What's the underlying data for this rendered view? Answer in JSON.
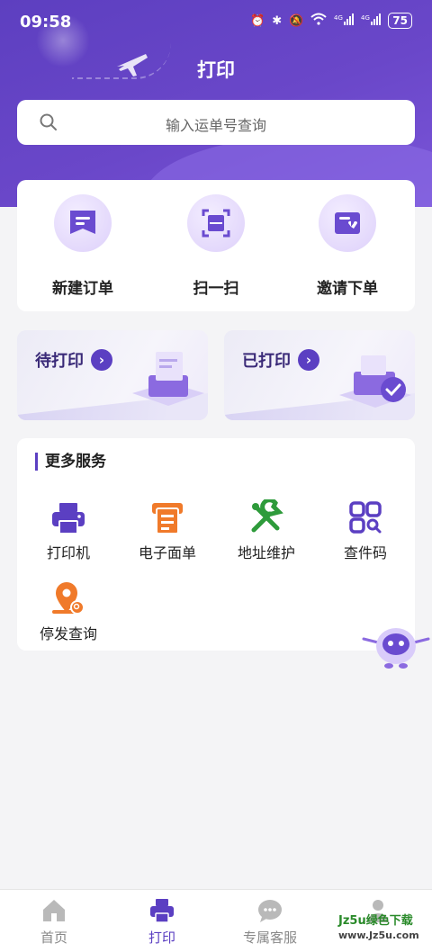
{
  "status_bar": {
    "time": "09:58",
    "battery": "75"
  },
  "header": {
    "title": "打印"
  },
  "search": {
    "placeholder": "输入运单号查询"
  },
  "quick_actions": [
    {
      "label": "新建订单",
      "icon": "new-order-icon"
    },
    {
      "label": "扫一扫",
      "icon": "scan-icon"
    },
    {
      "label": "邀请下单",
      "icon": "invite-icon"
    }
  ],
  "print_tiles": [
    {
      "label": "待打印",
      "icon": "printer-illustration"
    },
    {
      "label": "已打印",
      "icon": "printed-check-illustration"
    }
  ],
  "more_services": {
    "title": "更多服务",
    "items": [
      {
        "label": "打印机",
        "icon": "printer-icon"
      },
      {
        "label": "电子面单",
        "icon": "e-waybill-icon"
      },
      {
        "label": "地址维护",
        "icon": "wrench-icon"
      },
      {
        "label": "查件码",
        "icon": "query-code-icon"
      },
      {
        "label": "停发查询",
        "icon": "location-search-icon"
      }
    ]
  },
  "tab_bar": [
    {
      "label": "首页",
      "icon": "home-icon"
    },
    {
      "label": "打印",
      "icon": "printer-icon"
    },
    {
      "label": "专属客服",
      "icon": "chat-icon"
    },
    {
      "label": "",
      "icon": "user-icon"
    }
  ],
  "watermark": {
    "line1": "Jz5u绿色下载",
    "line2": "www.Jz5u.com"
  },
  "colors": {
    "primary": "#5b3fc2",
    "orange": "#f07a2a",
    "green": "#2e9b3b",
    "background": "#f4f4f6"
  }
}
